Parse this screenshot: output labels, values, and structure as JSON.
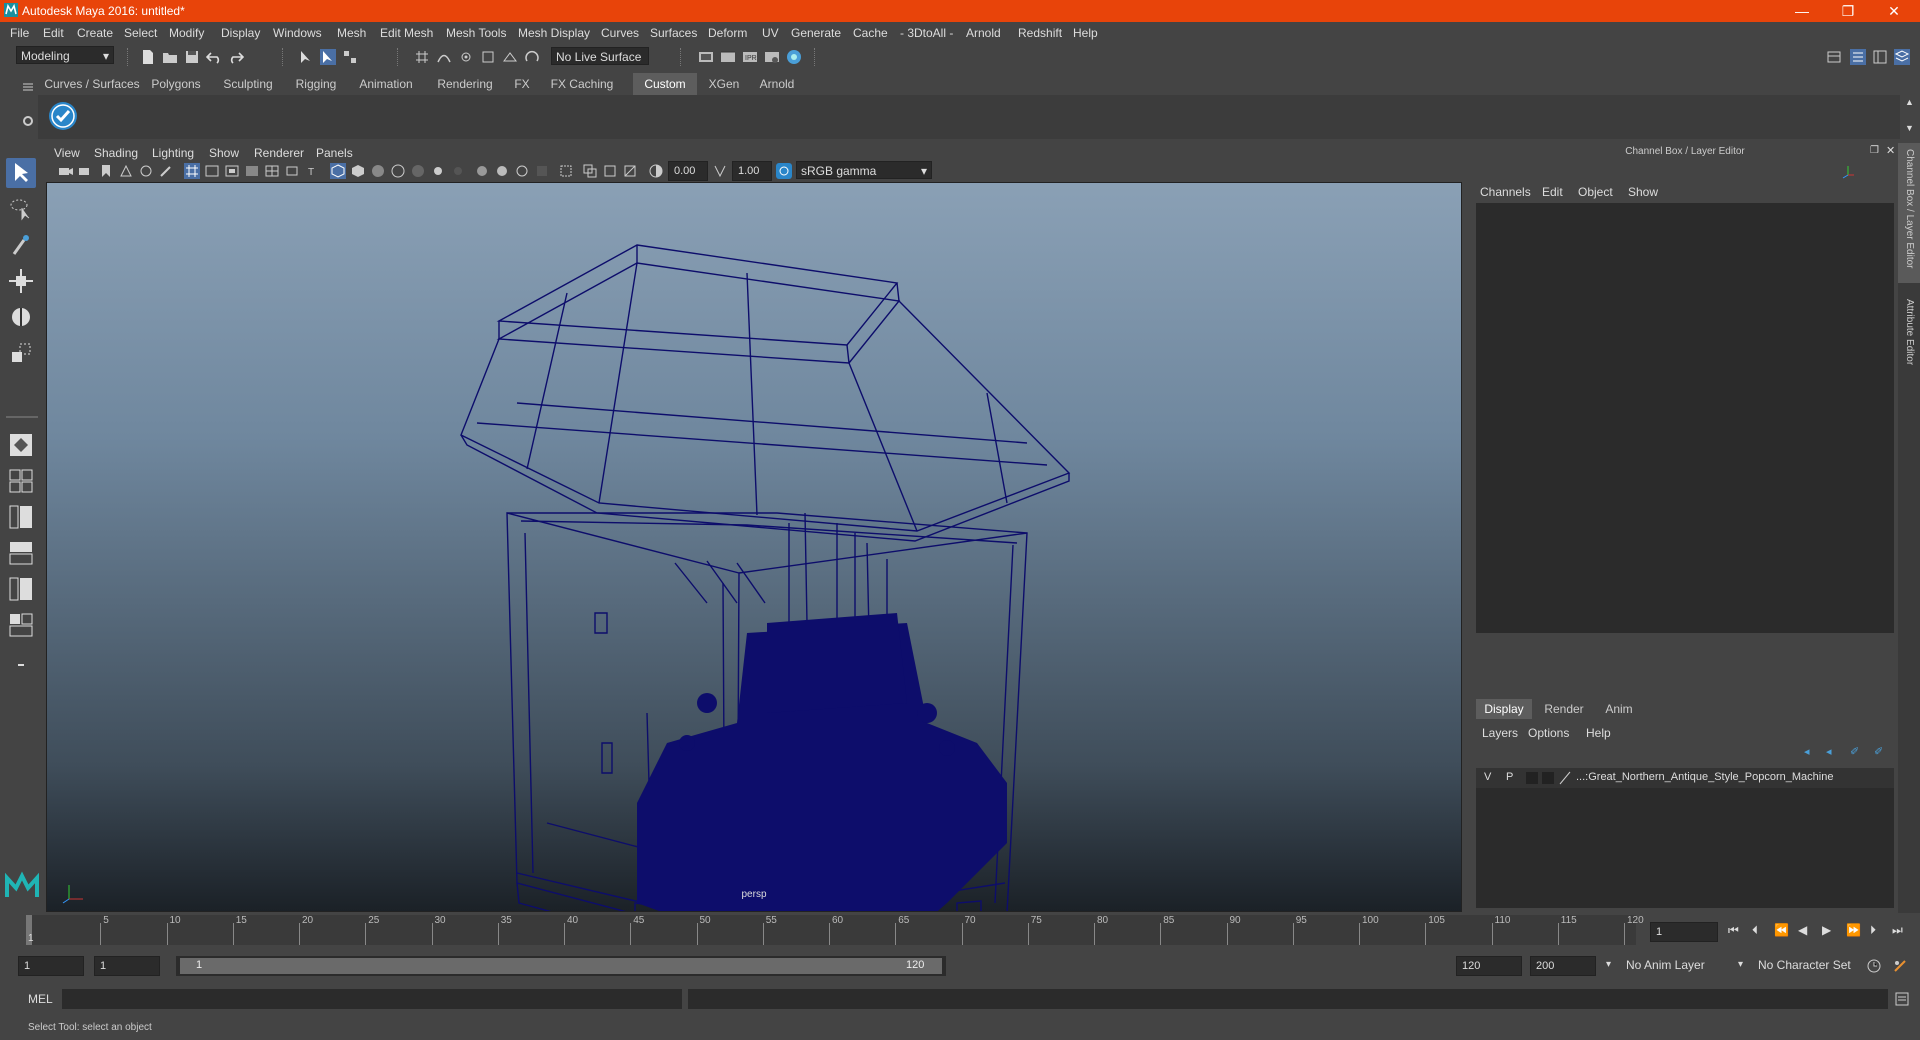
{
  "window": {
    "title": "Autodesk Maya 2016: untitled*",
    "minimize": "—",
    "restore": "❐",
    "close": "✕"
  },
  "menus": [
    "File",
    "Edit",
    "Create",
    "Select",
    "Modify",
    "Display",
    "Windows",
    "Mesh",
    "Edit Mesh",
    "Mesh Tools",
    "Mesh Display",
    "Curves",
    "Surfaces",
    "Deform",
    "UV",
    "Generate",
    "Cache",
    "- 3DtoAll -",
    "Arnold",
    "Redshift",
    "Help"
  ],
  "status": {
    "mode": "Modeling",
    "live_surface": "No Live Surface"
  },
  "shelf_tabs": [
    "Curves / Surfaces",
    "Polygons",
    "Sculpting",
    "Rigging",
    "Animation",
    "Rendering",
    "FX",
    "FX Caching",
    "Custom",
    "XGen",
    "Arnold"
  ],
  "shelf_active": "Custom",
  "viewport": {
    "menus": [
      "View",
      "Shading",
      "Lighting",
      "Show",
      "Renderer",
      "Panels"
    ],
    "exposure": "0.00",
    "gamma": "1.00",
    "color_space": "sRGB gamma",
    "camera_label": "persp",
    "wire_color": "#0d0d6b"
  },
  "channel_box": {
    "title": "Channel Box / Layer Editor",
    "menus": [
      "Channels",
      "Edit",
      "Object",
      "Show"
    ],
    "layer_tabs": [
      "Display",
      "Render",
      "Anim"
    ],
    "layer_menus": [
      "Layers",
      "Options",
      "Help"
    ],
    "layer": {
      "v": "V",
      "p": "P",
      "name": "...:Great_Northern_Antique_Style_Popcorn_Machine"
    },
    "side_tabs": [
      "Channel Box / Layer Editor",
      "Attribute Editor"
    ]
  },
  "timeline": {
    "ticks": [
      "5",
      "10",
      "15",
      "20",
      "25",
      "30",
      "35",
      "40",
      "45",
      "50",
      "55",
      "60",
      "65",
      "70",
      "75",
      "80",
      "85",
      "90",
      "95",
      "100",
      "105",
      "110",
      "115",
      "120"
    ],
    "current_marker": "1",
    "current_frame": "1"
  },
  "range": {
    "start": "1",
    "playback_start": "1",
    "slider_start": "1",
    "slider_end": "120",
    "playback_end": "120",
    "end": "200",
    "anim_layer": "No Anim Layer",
    "character_set": "No Character Set"
  },
  "command": {
    "lang": "MEL"
  },
  "help_line": "Select Tool: select an object",
  "colors": {
    "title_bar": "#e8440a",
    "accent_blue": "#4a9fd8",
    "panel": "#444444",
    "field": "#2b2b2b"
  }
}
